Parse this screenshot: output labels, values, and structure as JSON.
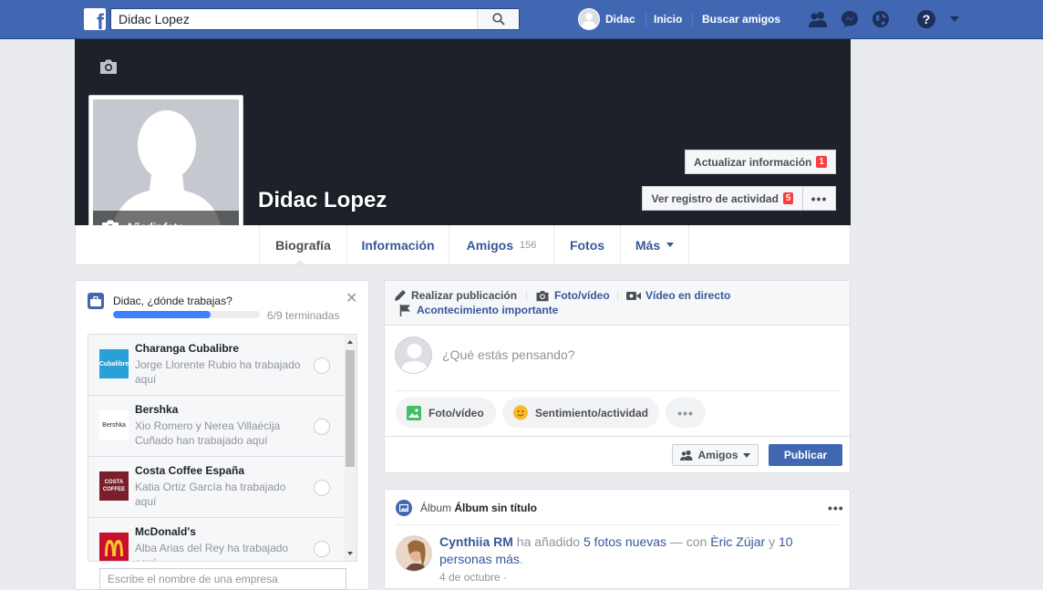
{
  "topbar": {
    "search_value": "Didac Lopez",
    "user_name": "Didac",
    "home_link": "Inicio",
    "find_friends_link": "Buscar amigos"
  },
  "profile": {
    "name": "Didac Lopez",
    "add_photo": "Añadir foto",
    "update_info": "Actualizar información",
    "update_info_badge": "1",
    "activity_log": "Ver registro de actividad",
    "activity_log_badge": "5",
    "more_dots": "•••"
  },
  "tabs": [
    {
      "label": "Biografía",
      "count": ""
    },
    {
      "label": "Información",
      "count": ""
    },
    {
      "label": "Amigos",
      "count": "156"
    },
    {
      "label": "Fotos",
      "count": ""
    },
    {
      "label": "Más",
      "count": ""
    }
  ],
  "work_card": {
    "title": "Didac, ¿dónde trabajas?",
    "close": "✕",
    "progress_fraction": 0.667,
    "progress_label": "6/9 terminadas",
    "companies": [
      {
        "name": "Charanga Cubalibre",
        "sub": "Jorge Llorente Rubio ha trabajado aquí"
      },
      {
        "name": "Bershka",
        "sub": "Xio Romero y Nerea Villaécija Cuñado han trabajado aquí"
      },
      {
        "name": "Costa Coffee España",
        "sub": "Katia Ortiz García ha trabajado aquí"
      },
      {
        "name": "McDonald's",
        "sub": "Alba Arias del Rey ha trabajado aquí"
      }
    ],
    "logo_labels": {
      "charanga": "Cubalibre",
      "bershka": "Bershka",
      "costa1": "COSTA",
      "costa2": "COFFEE"
    },
    "company_input_placeholder": "Escribe el nombre de una empresa"
  },
  "composer": {
    "opt_post": "Realizar publicación",
    "opt_photo": "Foto/vídeo",
    "opt_live": "Vídeo en directo",
    "opt_event": "Acontecimiento importante",
    "placeholder": "¿Qué estás pensando?",
    "pill_photo": "Foto/vídeo",
    "pill_feeling": "Sentimiento/actividad",
    "pill_more": "•••",
    "audience": "Amigos",
    "publish": "Publicar"
  },
  "album": {
    "prefix": "Álbum",
    "title": "Álbum sin título",
    "menu": "•••",
    "author": "Cynthiia RM",
    "action": " ha añadido ",
    "photos_link": "5 fotos nuevas",
    "with": " — con ",
    "tagged": "Èric Zújar",
    "and": " y ",
    "others_link": "10 personas más",
    "end": ".",
    "date": "4 de octubre · "
  },
  "colors": {
    "brand": "#4267b2",
    "link": "#365899",
    "badge": "#fa3e3e",
    "progress": "#4080ff"
  }
}
